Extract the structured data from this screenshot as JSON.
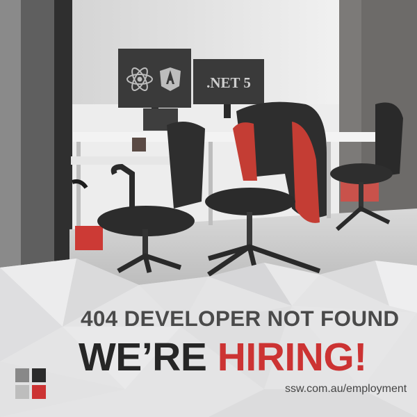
{
  "poster": {
    "headline": "404 DEVELOPER NOT FOUND",
    "cta_part1": "WE’RE ",
    "cta_part2": "HIRING!",
    "url": "ssw.com.au/employment"
  },
  "monitors": {
    "left_monitor_icons": [
      "react-logo-icon",
      "angular-logo-icon"
    ],
    "right_monitor_label": ".NET 5"
  },
  "colors": {
    "accent_red": "#cc3333",
    "text_dark": "#262626",
    "text_grey": "#4a4a4a",
    "logo_tiles": [
      "#888888",
      "#2b2b2b",
      "#bdbdbd",
      "#cc3333"
    ]
  }
}
